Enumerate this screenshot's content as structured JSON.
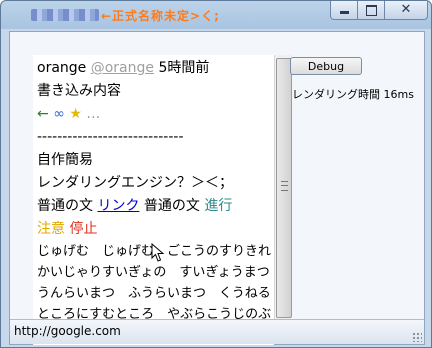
{
  "window": {
    "title": "←正式名称未定>く;",
    "buttons": {
      "minimize": "minimize",
      "maximize": "maximize",
      "close": "✕"
    }
  },
  "document": {
    "username": "orange",
    "handle": "@orange",
    "time_ago": "5時間前",
    "body_title": "書き込み内容",
    "action_icons": {
      "reply": "←",
      "retweet": "∞",
      "favorite": "★",
      "more": "…"
    },
    "separator": "-----------------------------",
    "heading": "自作簡易",
    "engine_line": "レンダリングエンジン？＞＜；",
    "normal_text_1": "普通の文",
    "link_text": "リンク",
    "normal_text_2": "普通の文",
    "progress_text": "進行",
    "caution_text": "注意",
    "stop_text": "停止",
    "jugemu_lines": [
      "じゅげむ　じゅげむ　ごこうのすりきれ",
      "かいじゃりすいぎょの　すいぎょうまつ",
      "うんらいまつ　ふうらいまつ　くうねる",
      "ところにすむところ　やぶらこうじのぶ"
    ]
  },
  "side": {
    "debug_button": "Debug",
    "render_time": "レンダリング時間 16ms"
  },
  "statusbar": {
    "url": "http://google.com"
  },
  "colors": {
    "link": "#0000dd",
    "progress": "#2a8a8a",
    "caution": "#e0a800",
    "stop": "#e03020",
    "title": "#ff7a1a"
  }
}
